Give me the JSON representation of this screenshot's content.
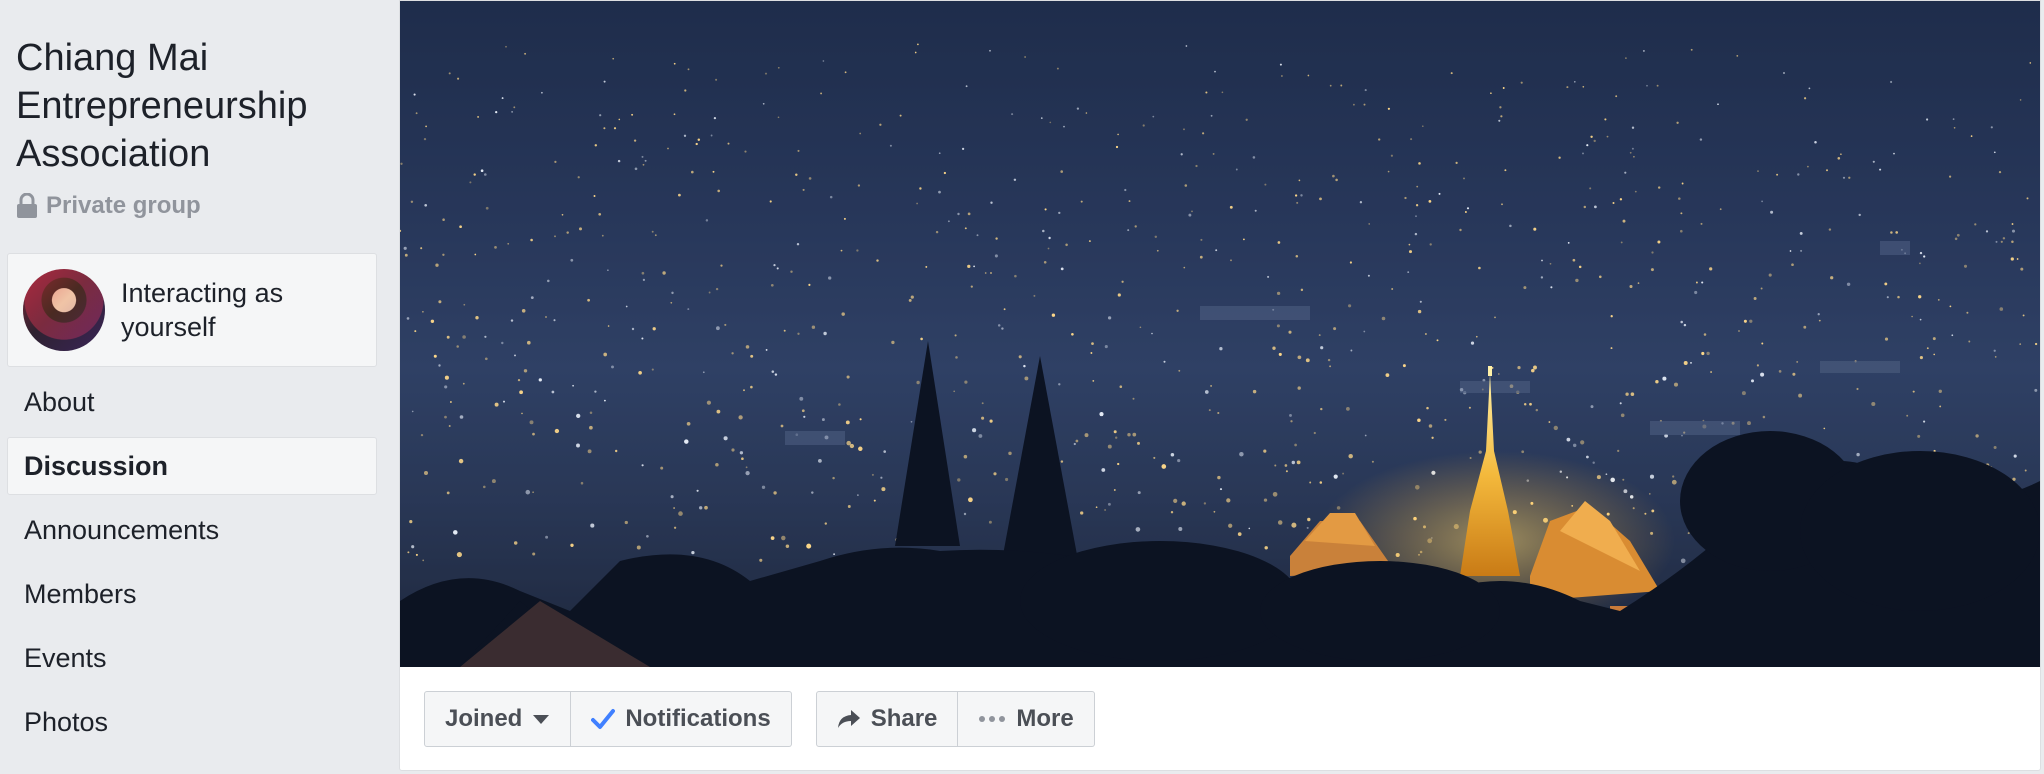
{
  "group": {
    "name": "Chiang Mai Entrepreneurship Association",
    "privacy": "Private group"
  },
  "actor": {
    "label": "Interacting as yourself"
  },
  "nav": {
    "items": [
      {
        "label": "About"
      },
      {
        "label": "Discussion"
      },
      {
        "label": "Announcements"
      },
      {
        "label": "Members"
      },
      {
        "label": "Events"
      },
      {
        "label": "Photos"
      }
    ]
  },
  "actions": {
    "joined": "Joined",
    "notifications": "Notifications",
    "share": "Share",
    "more": "More"
  },
  "colors": {
    "accent": "#4267b2",
    "check": "#4080ff",
    "background": "#e9ebee"
  },
  "icons": {
    "privacy": "lock-icon",
    "joined": "caret-down-icon",
    "notifications": "checkmark-icon",
    "share": "share-arrow-icon",
    "more": "ellipsis-icon"
  }
}
